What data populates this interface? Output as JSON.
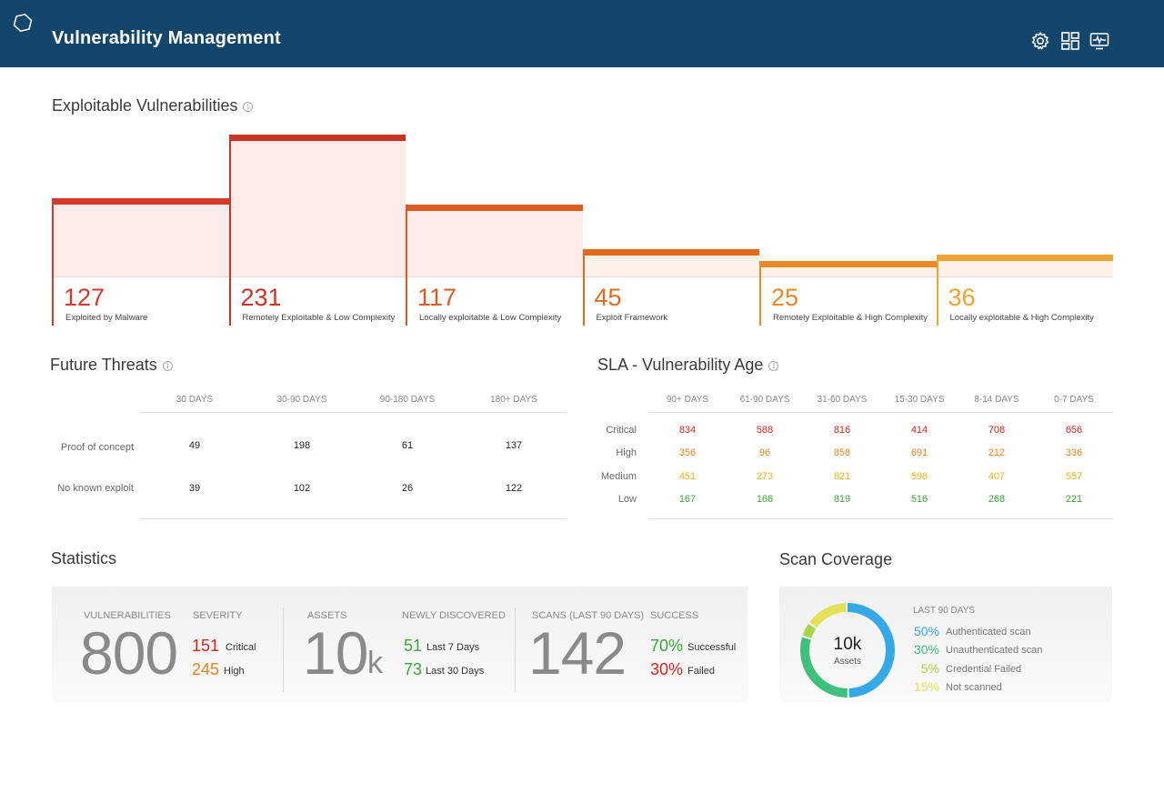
{
  "header": {
    "title": "Vulnerability Management",
    "icons": [
      "logo-hexagon-icon",
      "gear-icon",
      "dashboard-grid-icon",
      "monitor-icon"
    ]
  },
  "exploitable": {
    "title": "Exploitable Vulnerabilities",
    "items": [
      {
        "value": "127",
        "label": "Exploited by Malware",
        "color": "#d43a2a"
      },
      {
        "value": "231",
        "label": "Remotely Exploitable & Low Complexity",
        "color": "#c93424"
      },
      {
        "value": "117",
        "label": "Locally exploitable & Low Complexity",
        "color": "#dd5a22"
      },
      {
        "value": "45",
        "label": "Exploit Framework",
        "color": "#e06b1f"
      },
      {
        "value": "25",
        "label": "Remotely Exploitable & High Complexity",
        "color": "#e88a2a"
      },
      {
        "value": "36",
        "label": "Locally exploitable & High Complexity",
        "color": "#f0a232"
      }
    ]
  },
  "future_threats": {
    "title": "Future Threats",
    "columns": [
      "30 DAYS",
      "30-90 DAYS",
      "90-180 DAYS",
      "180+ DAYS"
    ],
    "rows": [
      {
        "label": "Proof of concept",
        "values": [
          "49",
          "198",
          "61",
          "137"
        ]
      },
      {
        "label": "No known exploit",
        "values": [
          "39",
          "102",
          "26",
          "122"
        ]
      }
    ]
  },
  "sla": {
    "title": "SLA - Vulnerability Age",
    "columns": [
      "90+ DAYS",
      "61-90 DAYS",
      "31-60 DAYS",
      "15-30 DAYS",
      "8-14 DAYS",
      "0-7 DAYS"
    ],
    "rows": [
      {
        "label": "Critical",
        "color": "#d0281e",
        "values": [
          "834",
          "588",
          "816",
          "414",
          "708",
          "656"
        ]
      },
      {
        "label": "High",
        "color": "#e88421",
        "values": [
          "356",
          "96",
          "858",
          "691",
          "212",
          "336"
        ]
      },
      {
        "label": "Medium",
        "color": "#efb21a",
        "values": [
          "451",
          "273",
          "821",
          "598",
          "407",
          "557"
        ]
      },
      {
        "label": "Low",
        "color": "#3aa63a",
        "values": [
          "167",
          "166",
          "819",
          "516",
          "268",
          "221"
        ]
      }
    ]
  },
  "statistics": {
    "title": "Statistics",
    "vulnerabilities": {
      "label": "VULNERABILITIES",
      "value": "800"
    },
    "severity": {
      "label": "SEVERITY",
      "critical_num": "151",
      "critical_txt": "Critical",
      "high_num": "245",
      "high_txt": "High"
    },
    "assets": {
      "label": "ASSETS",
      "value": "10",
      "suffix": "k"
    },
    "newly": {
      "label": "NEWLY DISCOVERED",
      "n1": "51",
      "t1": "Last 7 Days",
      "n2": "73",
      "t2": "Last 30 Days"
    },
    "scans": {
      "label": "SCANS (LAST 90 DAYS)",
      "value": "142"
    },
    "success": {
      "label": "SUCCESS",
      "n1": "70%",
      "t1": "Successful",
      "n2": "30%",
      "t2": "Failed"
    }
  },
  "scan_coverage": {
    "title": "Scan Coverage",
    "center_value": "10k",
    "center_label": "Assets",
    "period": "LAST 90 DAYS",
    "segments": [
      {
        "pct": "50%",
        "fraction": 0.5,
        "label": "Authenticated scan",
        "color": "#35a9e8"
      },
      {
        "pct": "30%",
        "fraction": 0.3,
        "label": "Unauthenticated scan",
        "color": "#3fc07c"
      },
      {
        "pct": "5%",
        "fraction": 0.05,
        "label": "Credential Failed",
        "color": "#a8d44a"
      },
      {
        "pct": "15%",
        "fraction": 0.15,
        "label": "Not scanned",
        "color": "#e4e05a"
      }
    ]
  }
}
